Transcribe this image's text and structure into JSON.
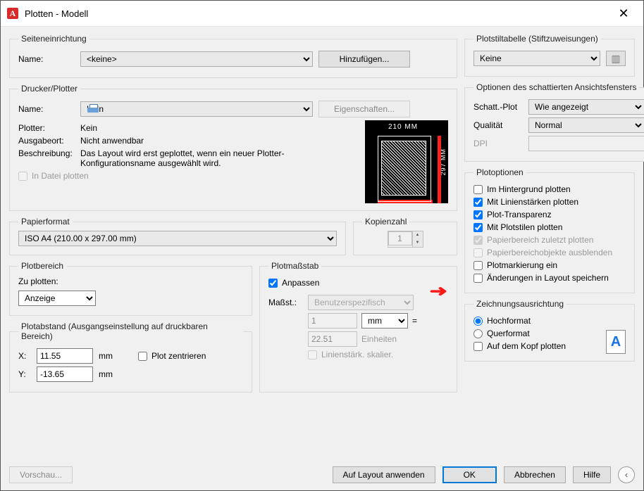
{
  "window": {
    "title": "Plotten - Modell"
  },
  "pageSetup": {
    "legend": "Seiteneinrichtung",
    "name_label": "Name:",
    "name_value": "<keine>",
    "add_btn": "Hinzufügen..."
  },
  "printer": {
    "legend": "Drucker/Plotter",
    "name_label": "Name:",
    "name_value": "Kein",
    "props_btn": "Eigenschaften...",
    "plotter_label": "Plotter:",
    "plotter_value": "Kein",
    "output_label": "Ausgabeort:",
    "output_value": "Nicht anwendbar",
    "desc_label": "Beschreibung:",
    "desc_value": "Das Layout wird erst geplottet, wenn ein neuer Plotter-Konfigurationsname ausgewählt wird.",
    "plot_to_file": "In Datei plotten",
    "preview_w": "210 MM",
    "preview_h": "297 MM"
  },
  "paper": {
    "legend": "Papierformat",
    "value": "ISO A4 (210.00 x 297.00 mm)"
  },
  "copies": {
    "legend": "Kopienzahl",
    "value": "1"
  },
  "plotArea": {
    "legend": "Plotbereich",
    "what_label": "Zu plotten:",
    "what_value": "Anzeige"
  },
  "plotScale": {
    "legend": "Plotmaßstab",
    "fit": "Anpassen",
    "scale_label": "Maßst.:",
    "scale_value": "Benutzerspezifisch",
    "num": "1",
    "unit": "mm",
    "equals": "=",
    "units_val": "22.51",
    "units_label": "Einheiten",
    "scale_lw": "Linienstärk. skalier."
  },
  "offset": {
    "legend": "Plotabstand (Ausgangseinstellung auf druckbaren Bereich)",
    "x_label": "X:",
    "x_value": "11.55",
    "y_label": "Y:",
    "y_value": "-13.65",
    "unit": "mm",
    "center": "Plot zentrieren"
  },
  "styleTable": {
    "legend": "Plotstiltabelle (Stiftzuweisungen)",
    "value": "Keine"
  },
  "shaded": {
    "legend": "Optionen des schattierten Ansichtsfensters",
    "shade_label": "Schatt.-Plot",
    "shade_value": "Wie angezeigt",
    "quality_label": "Qualität",
    "quality_value": "Normal",
    "dpi_label": "DPI",
    "dpi_value": ""
  },
  "plotOptions": {
    "legend": "Plotoptionen",
    "bg": "Im Hintergrund plotten",
    "lw": "Mit Linienstärken plotten",
    "transp": "Plot-Transparenz",
    "styles": "Mit Plotstilen plotten",
    "paper_last": "Papierbereich zuletzt plotten",
    "hide_paper": "Papierbereichobjekte ausblenden",
    "stamp": "Plotmarkierung ein",
    "save_layout": "Änderungen in Layout speichern"
  },
  "orientation": {
    "legend": "Zeichnungsausrichtung",
    "portrait": "Hochformat",
    "landscape": "Querformat",
    "upside": "Auf dem Kopf plotten"
  },
  "footer": {
    "preview": "Vorschau...",
    "apply": "Auf Layout anwenden",
    "ok": "OK",
    "cancel": "Abbrechen",
    "help": "Hilfe"
  }
}
